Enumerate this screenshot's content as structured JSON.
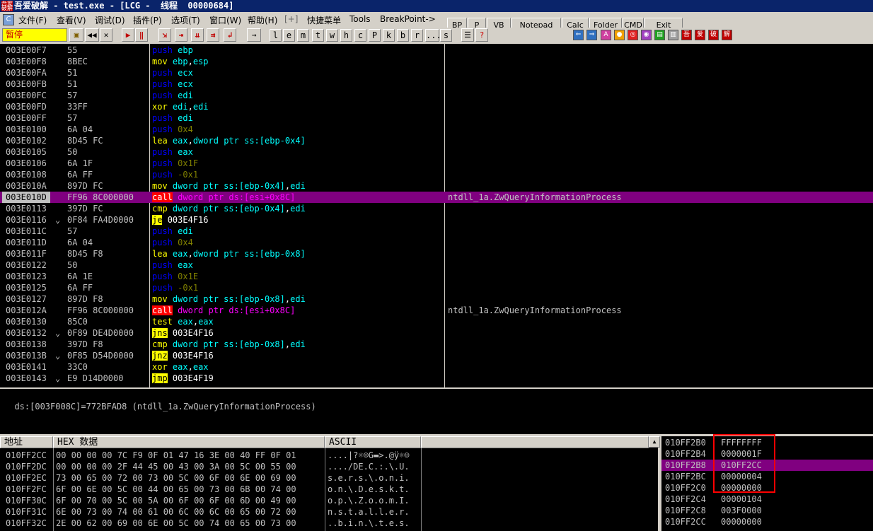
{
  "title": {
    "app_icon_text": "吾爱破解",
    "text": "吾爱破解 - test.exe - [LCG -  线程  00000684]"
  },
  "menu": [
    "文件(F)",
    "查看(V)",
    "调试(D)",
    "插件(P)",
    "选项(T)",
    "窗口(W)",
    "帮助(H)",
    "[+]",
    "快捷菜单",
    "Tools",
    "BreakPoint->"
  ],
  "toolbar": {
    "status": "暂停",
    "letters": [
      "l",
      "e",
      "m",
      "t",
      "w",
      "h",
      "c",
      "P",
      "k",
      "b",
      "r",
      "...",
      "s"
    ],
    "plugin_buttons": [
      "BP",
      "P",
      "VB",
      "Notepad",
      "Calc",
      "Folder",
      "CMD",
      "Exit"
    ],
    "chinese_icons": [
      "吾",
      "爱",
      "破",
      "解"
    ]
  },
  "disasm": {
    "rows": [
      {
        "addr": "003E00F7",
        "j": "",
        "hex": "55",
        "mn": "push",
        "mc": "m-push",
        "ops": [
          {
            "t": "ebp",
            "c": "op-reg"
          }
        ],
        "cmt": ""
      },
      {
        "addr": "003E00F8",
        "j": "",
        "hex": "8BEC",
        "mn": "mov",
        "mc": "m-mov",
        "ops": [
          {
            "t": "ebp",
            "c": "op-reg"
          },
          {
            "t": ",",
            "c": "op-jmp"
          },
          {
            "t": "esp",
            "c": "op-reg"
          }
        ],
        "cmt": ""
      },
      {
        "addr": "003E00FA",
        "j": "",
        "hex": "51",
        "mn": "push",
        "mc": "m-push",
        "ops": [
          {
            "t": "ecx",
            "c": "op-reg"
          }
        ],
        "cmt": ""
      },
      {
        "addr": "003E00FB",
        "j": "",
        "hex": "51",
        "mn": "push",
        "mc": "m-push",
        "ops": [
          {
            "t": "ecx",
            "c": "op-reg"
          }
        ],
        "cmt": ""
      },
      {
        "addr": "003E00FC",
        "j": "",
        "hex": "57",
        "mn": "push",
        "mc": "m-push",
        "ops": [
          {
            "t": "edi",
            "c": "op-reg"
          }
        ],
        "cmt": ""
      },
      {
        "addr": "003E00FD",
        "j": "",
        "hex": "33FF",
        "mn": "xor",
        "mc": "m-xor",
        "ops": [
          {
            "t": "edi",
            "c": "op-reg"
          },
          {
            "t": ",",
            "c": "op-jmp"
          },
          {
            "t": "edi",
            "c": "op-reg"
          }
        ],
        "cmt": ""
      },
      {
        "addr": "003E00FF",
        "j": "",
        "hex": "57",
        "mn": "push",
        "mc": "m-push",
        "ops": [
          {
            "t": "edi",
            "c": "op-reg"
          }
        ],
        "cmt": ""
      },
      {
        "addr": "003E0100",
        "j": "",
        "hex": "6A 04",
        "mn": "push",
        "mc": "m-push",
        "ops": [
          {
            "t": "0x4",
            "c": "op-imm"
          }
        ],
        "cmt": ""
      },
      {
        "addr": "003E0102",
        "j": "",
        "hex": "8D45 FC",
        "mn": "lea",
        "mc": "m-lea",
        "ops": [
          {
            "t": "eax",
            "c": "op-reg"
          },
          {
            "t": ",",
            "c": "op-jmp"
          },
          {
            "t": "dword ptr ss:[ebp-0x4]",
            "c": "op-ptr"
          }
        ],
        "cmt": ""
      },
      {
        "addr": "003E0105",
        "j": "",
        "hex": "50",
        "mn": "push",
        "mc": "m-push",
        "ops": [
          {
            "t": "eax",
            "c": "op-reg"
          }
        ],
        "cmt": ""
      },
      {
        "addr": "003E0106",
        "j": "",
        "hex": "6A 1F",
        "mn": "push",
        "mc": "m-push",
        "ops": [
          {
            "t": "0x1F",
            "c": "op-imm"
          }
        ],
        "cmt": ""
      },
      {
        "addr": "003E0108",
        "j": "",
        "hex": "6A FF",
        "mn": "push",
        "mc": "m-push",
        "ops": [
          {
            "t": "-0x1",
            "c": "op-imm"
          }
        ],
        "cmt": ""
      },
      {
        "addr": "003E010A",
        "j": "",
        "hex": "897D FC",
        "mn": "mov",
        "mc": "m-mov",
        "ops": [
          {
            "t": "dword ptr ss:[ebp-0x4]",
            "c": "op-ptr"
          },
          {
            "t": ",",
            "c": "op-jmp"
          },
          {
            "t": "edi",
            "c": "op-reg"
          }
        ],
        "cmt": ""
      },
      {
        "addr": "003E010D",
        "j": "",
        "hex": "FF96 8C000000",
        "mn": "call",
        "mc": "m-call",
        "ops": [
          {
            "t": "dword ptr ds:[esi+0x8C]",
            "c": "op-calltarget"
          }
        ],
        "cmt": "ntdll_1a.ZwQueryInformationProcess",
        "sel": true
      },
      {
        "addr": "003E0113",
        "j": "",
        "hex": "397D FC",
        "mn": "cmp",
        "mc": "m-cmp",
        "ops": [
          {
            "t": "dword ptr ss:[ebp-0x4]",
            "c": "op-ptr"
          },
          {
            "t": ",",
            "c": "op-jmp"
          },
          {
            "t": "edi",
            "c": "op-reg"
          }
        ],
        "cmt": ""
      },
      {
        "addr": "003E0116",
        "j": "⌄",
        "hex": "0F84 FA4D0000",
        "mn": "je",
        "mc": "m-jcc",
        "ops": [
          {
            "t": "003E4F16",
            "c": "op-jmp"
          }
        ],
        "cmt": ""
      },
      {
        "addr": "003E011C",
        "j": "",
        "hex": "57",
        "mn": "push",
        "mc": "m-push",
        "ops": [
          {
            "t": "edi",
            "c": "op-reg"
          }
        ],
        "cmt": ""
      },
      {
        "addr": "003E011D",
        "j": "",
        "hex": "6A 04",
        "mn": "push",
        "mc": "m-push",
        "ops": [
          {
            "t": "0x4",
            "c": "op-imm"
          }
        ],
        "cmt": ""
      },
      {
        "addr": "003E011F",
        "j": "",
        "hex": "8D45 F8",
        "mn": "lea",
        "mc": "m-lea",
        "ops": [
          {
            "t": "eax",
            "c": "op-reg"
          },
          {
            "t": ",",
            "c": "op-jmp"
          },
          {
            "t": "dword ptr ss:[ebp-0x8]",
            "c": "op-ptr"
          }
        ],
        "cmt": ""
      },
      {
        "addr": "003E0122",
        "j": "",
        "hex": "50",
        "mn": "push",
        "mc": "m-push",
        "ops": [
          {
            "t": "eax",
            "c": "op-reg"
          }
        ],
        "cmt": ""
      },
      {
        "addr": "003E0123",
        "j": "",
        "hex": "6A 1E",
        "mn": "push",
        "mc": "m-push",
        "ops": [
          {
            "t": "0x1E",
            "c": "op-imm"
          }
        ],
        "cmt": ""
      },
      {
        "addr": "003E0125",
        "j": "",
        "hex": "6A FF",
        "mn": "push",
        "mc": "m-push",
        "ops": [
          {
            "t": "-0x1",
            "c": "op-imm"
          }
        ],
        "cmt": ""
      },
      {
        "addr": "003E0127",
        "j": "",
        "hex": "897D F8",
        "mn": "mov",
        "mc": "m-mov",
        "ops": [
          {
            "t": "dword ptr ss:[ebp-0x8]",
            "c": "op-ptr"
          },
          {
            "t": ",",
            "c": "op-jmp"
          },
          {
            "t": "edi",
            "c": "op-reg"
          }
        ],
        "cmt": ""
      },
      {
        "addr": "003E012A",
        "j": "",
        "hex": "FF96 8C000000",
        "mn": "call",
        "mc": "m-call",
        "ops": [
          {
            "t": "dword ptr ds:[esi+0x8C]",
            "c": "op-calltarget"
          }
        ],
        "cmt": "ntdll_1a.ZwQueryInformationProcess"
      },
      {
        "addr": "003E0130",
        "j": "",
        "hex": "85C0",
        "mn": "test",
        "mc": "m-test",
        "ops": [
          {
            "t": "eax",
            "c": "op-reg"
          },
          {
            "t": ",",
            "c": "op-jmp"
          },
          {
            "t": "eax",
            "c": "op-reg"
          }
        ],
        "cmt": ""
      },
      {
        "addr": "003E0132",
        "j": "⌄",
        "hex": "0F89 DE4D0000",
        "mn": "jns",
        "mc": "m-jcc",
        "ops": [
          {
            "t": "003E4F16",
            "c": "op-jmp"
          }
        ],
        "cmt": ""
      },
      {
        "addr": "003E0138",
        "j": "",
        "hex": "397D F8",
        "mn": "cmp",
        "mc": "m-cmp",
        "ops": [
          {
            "t": "dword ptr ss:[ebp-0x8]",
            "c": "op-ptr"
          },
          {
            "t": ",",
            "c": "op-jmp"
          },
          {
            "t": "edi",
            "c": "op-reg"
          }
        ],
        "cmt": ""
      },
      {
        "addr": "003E013B",
        "j": "⌄",
        "hex": "0F85 D54D0000",
        "mn": "jnz",
        "mc": "m-jcc",
        "ops": [
          {
            "t": "003E4F16",
            "c": "op-jmp"
          }
        ],
        "cmt": ""
      },
      {
        "addr": "003E0141",
        "j": "",
        "hex": "33C0",
        "mn": "xor",
        "mc": "m-xor",
        "ops": [
          {
            "t": "eax",
            "c": "op-reg"
          },
          {
            "t": ",",
            "c": "op-jmp"
          },
          {
            "t": "eax",
            "c": "op-reg"
          }
        ],
        "cmt": ""
      },
      {
        "addr": "003E0143",
        "j": "⌄",
        "hex": "E9 D14D0000",
        "mn": "jmp",
        "mc": "m-jcc",
        "ops": [
          {
            "t": "003E4F19",
            "c": "op-jmp"
          }
        ],
        "cmt": ""
      }
    ]
  },
  "info": {
    "text": "ds:[003F008C]=772BFAD8 (ntdll_1a.ZwQueryInformationProcess)"
  },
  "dump": {
    "headers": {
      "addr": "地址",
      "hex": "HEX 数据",
      "ascii": "ASCII"
    },
    "rows": [
      {
        "addr": "010FF2CC",
        "hex": "00 00 00 00 7C F9 0F 01 47 16 3E 00 40 FF 0F 01",
        "ascii": "....|?☼☺G▬>.@ÿ☼☺"
      },
      {
        "addr": "010FF2DC",
        "hex": "00 00 00 00 2F 44 45 00 43 00 3A 00 5C 00 55 00",
        "ascii": "..../DE.C.:.\\.U."
      },
      {
        "addr": "010FF2EC",
        "hex": "73 00 65 00 72 00 73 00 5C 00 6F 00 6E 00 69 00",
        "ascii": "s.e.r.s.\\.o.n.i."
      },
      {
        "addr": "010FF2FC",
        "hex": "6F 00 6E 00 5C 00 44 00 65 00 73 00 6B 00 74 00",
        "ascii": "o.n.\\.D.e.s.k.t."
      },
      {
        "addr": "010FF30C",
        "hex": "6F 00 70 00 5C 00 5A 00 6F 00 6F 00 6D 00 49 00",
        "ascii": "o.p.\\.Z.o.o.m.I."
      },
      {
        "addr": "010FF31C",
        "hex": "6E 00 73 00 74 00 61 00 6C 00 6C 00 65 00 72 00",
        "ascii": "n.s.t.a.l.l.e.r."
      },
      {
        "addr": "010FF32C",
        "hex": "2E 00 62 00 69 00 6E 00 5C 00 74 00 65 00 73 00",
        "ascii": "..b.i.n.\\.t.e.s."
      }
    ]
  },
  "stack": {
    "rows": [
      {
        "addr": "010FF2B0",
        "val": "FFFFFFFF"
      },
      {
        "addr": "010FF2B4",
        "val": "0000001F"
      },
      {
        "addr": "010FF2B8",
        "val": "010FF2CC",
        "sel": true
      },
      {
        "addr": "010FF2BC",
        "val": "00000004"
      },
      {
        "addr": "010FF2C0",
        "val": "00000000"
      },
      {
        "addr": "010FF2C4",
        "val": "00000104"
      },
      {
        "addr": "010FF2C8",
        "val": "003F0000"
      },
      {
        "addr": "010FF2CC",
        "val": "00000000"
      }
    ]
  },
  "colors": {
    "selection": "#800080",
    "highlight_box": "#ff0000",
    "status_bg": "#ffff00"
  }
}
